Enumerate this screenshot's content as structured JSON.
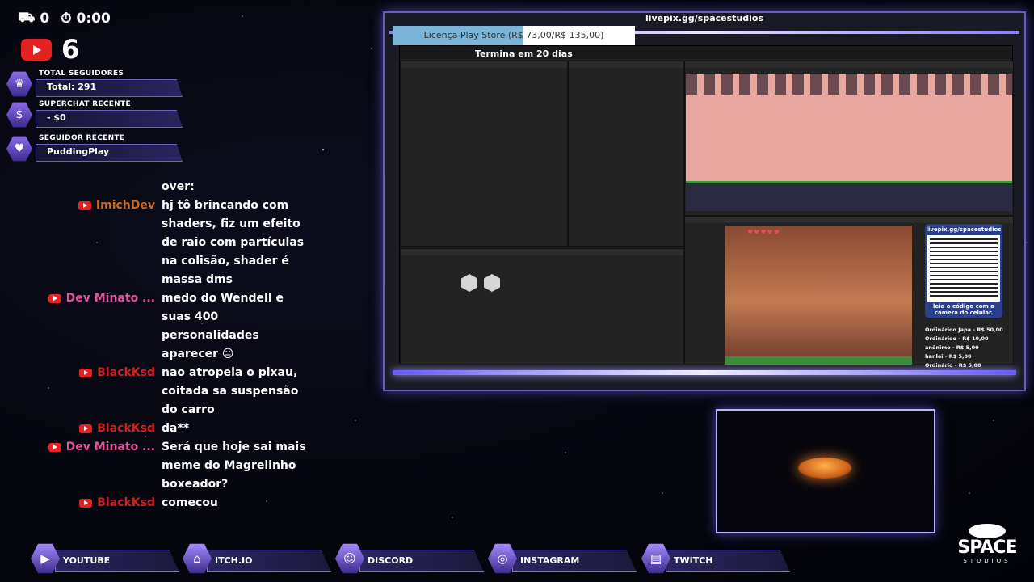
{
  "top_stats": {
    "likes": "0",
    "timer": "0:00"
  },
  "youtube": {
    "count": "6"
  },
  "panels": [
    {
      "title": "TOTAL SEGUIDORES",
      "value": "Total: 291",
      "icon": "crown-icon"
    },
    {
      "title": "SUPERCHAT RECENTE",
      "value": "- $0",
      "icon": "money-bag-icon"
    },
    {
      "title": "SEGUIDOR RECENTE",
      "value": "PuddingPlay",
      "icon": "heart-icon"
    }
  ],
  "chat": [
    {
      "user": "",
      "text": "over:",
      "color": "#ffffff"
    },
    {
      "user": "ImichDev",
      "text": "hj tô brincando com shaders, fiz um efeito de raio com partículas na colisão, shader é massa dms",
      "color": "#d2691e"
    },
    {
      "user": "Dev Minato ...",
      "text": "medo do Wendell e suas 400 personalidades aparecer 😐",
      "color": "#e0569a"
    },
    {
      "user": "BlackKsd",
      "text": "nao atropela o pixau, coitada sa suspensão do carro",
      "color": "#cc2222"
    },
    {
      "user": "BlackKsd",
      "text": "da**",
      "color": "#cc2222"
    },
    {
      "user": "Dev Minato ...",
      "text": "Será que hoje sai mais meme do Magrelinho boxeador?",
      "color": "#e0569a"
    },
    {
      "user": "BlackKsd",
      "text": "começou",
      "color": "#cc2222"
    }
  ],
  "capture": {
    "url": "livepix.gg/spacestudios",
    "goal_label": "Licença Play Store (R$ 73,00/R$ 135,00)",
    "goal_progress": 0.54,
    "ends": "Termina em 20 dias"
  },
  "qr": {
    "url": "livepix.gg/spacestudios",
    "caption": "leia o código com a câmera do celular."
  },
  "donors": [
    "Ordinárioo Japa - R$ 50,00",
    "Ordinárioo - R$ 10,00",
    "anônimo - R$ 5,00",
    "hanlei - R$ 5,00",
    "Ordinário - R$ 5,00"
  ],
  "social": [
    {
      "label": "YOUTUBE",
      "icon": "youtube-icon"
    },
    {
      "label": "ITCH.IO",
      "icon": "itchio-icon"
    },
    {
      "label": "DISCORD",
      "icon": "discord-icon"
    },
    {
      "label": "INSTAGRAM",
      "icon": "instagram-icon"
    },
    {
      "label": "TWITCH",
      "icon": "twitch-icon"
    }
  ],
  "brand": {
    "name": "SPACE",
    "sub": "STUDIOS"
  }
}
